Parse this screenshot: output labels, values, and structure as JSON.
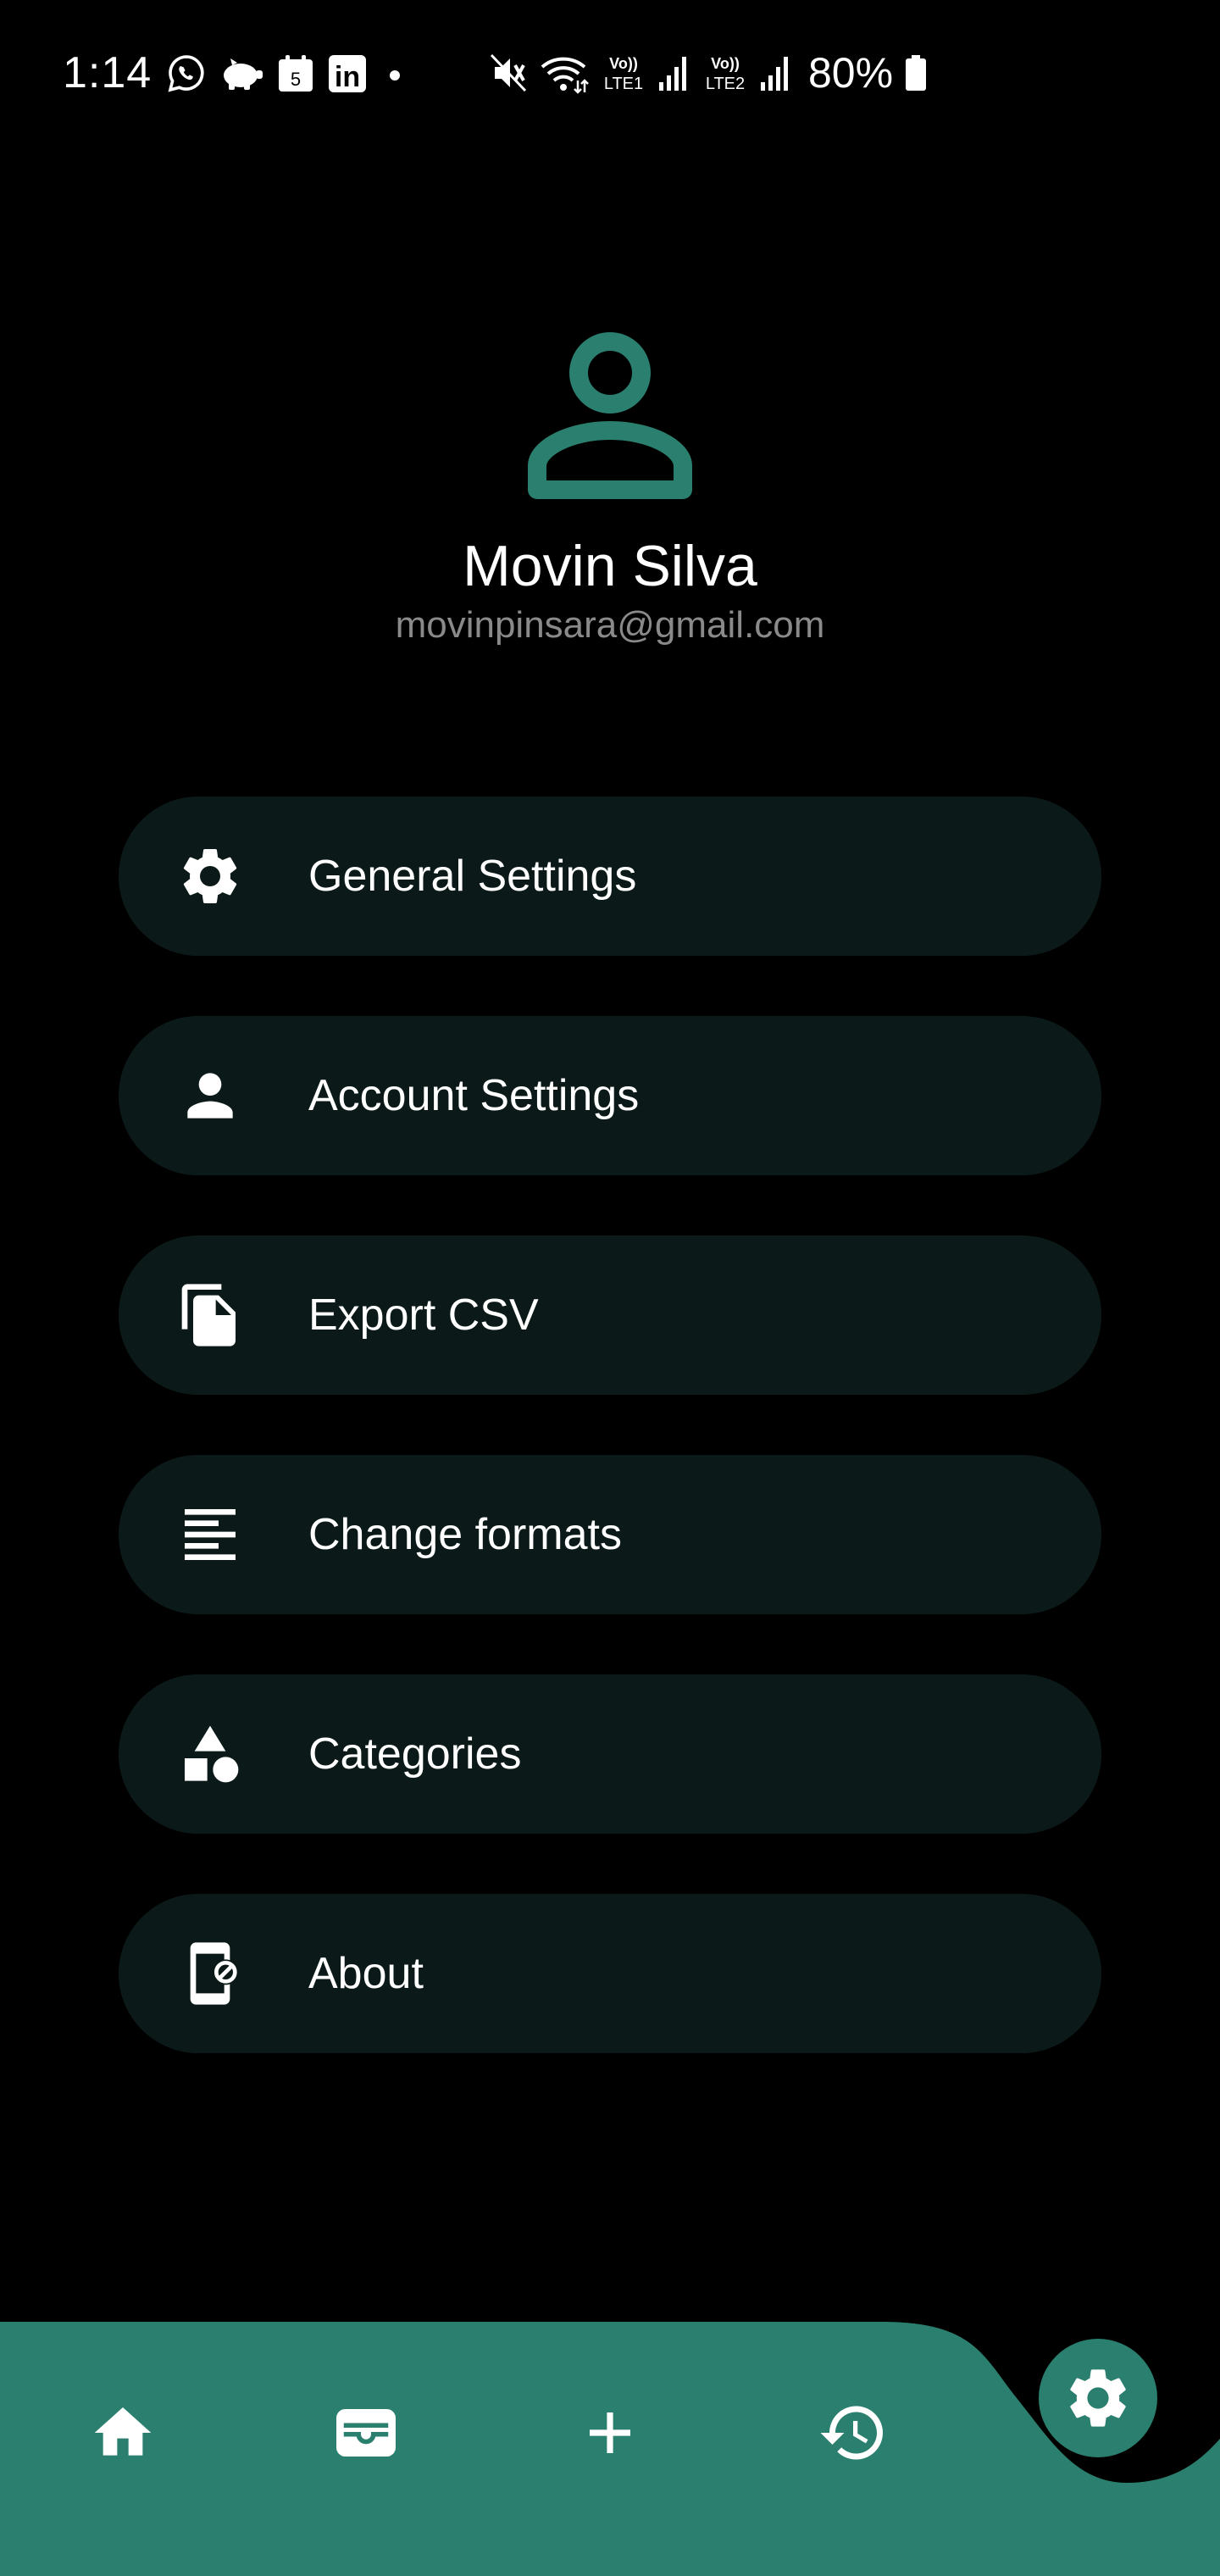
{
  "status_bar": {
    "time": "1:14",
    "battery_percent": "80%",
    "left_icons": [
      "whatsapp-icon",
      "piggy-bank-icon",
      "calendar-icon",
      "linkedin-icon",
      "dot-icon"
    ],
    "calendar_day": "5",
    "linkedin_text": "in",
    "right_icons": [
      "mute-icon",
      "wifi-icon",
      "volte-lte1-icon",
      "signal-1-icon",
      "volte-lte2-icon",
      "signal-2-icon",
      "battery-icon"
    ],
    "volte1_top": "Vo))",
    "volte1_bottom": "LTE1",
    "volte2_top": "Vo))",
    "volte2_bottom": "LTE2"
  },
  "profile": {
    "name": "Movin Silva",
    "email": "movinpinsara@gmail.com",
    "avatar_icon": "person-outline-icon"
  },
  "menu": {
    "items": [
      {
        "label": "General Settings",
        "icon": "gear-icon"
      },
      {
        "label": "Account Settings",
        "icon": "person-icon"
      },
      {
        "label": "Export CSV",
        "icon": "copy-file-icon"
      },
      {
        "label": "Change formats",
        "icon": "text-lines-icon"
      },
      {
        "label": "Categories",
        "icon": "shapes-icon"
      },
      {
        "label": "About",
        "icon": "device-info-icon"
      }
    ]
  },
  "bottom_nav": {
    "items": [
      {
        "icon": "home-icon"
      },
      {
        "icon": "wallet-icon"
      },
      {
        "icon": "plus-icon"
      },
      {
        "icon": "history-icon"
      }
    ],
    "active": {
      "icon": "gear-icon"
    }
  },
  "colors": {
    "background": "#000000",
    "accent": "#2a7f6e",
    "menu_item_bg": "#0b1a18",
    "text_primary": "#ffffff",
    "text_secondary": "#8a8a8a"
  }
}
